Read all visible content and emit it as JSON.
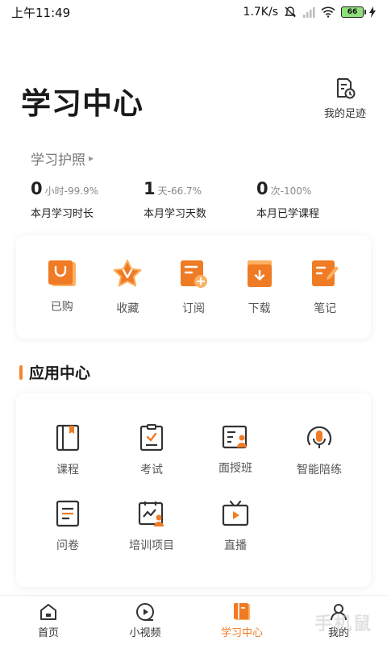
{
  "status_bar": {
    "time": "上午11:49",
    "net_speed": "1.7K/s",
    "battery": "66"
  },
  "header": {
    "title": "学习中心",
    "footprint_label": "我的足迹"
  },
  "passport": {
    "title": "学习护照",
    "stats": [
      {
        "value": "0",
        "unit": "小时-99.9%",
        "label": "本月学习时长"
      },
      {
        "value": "1",
        "unit": "天-66.7%",
        "label": "本月学习天数"
      },
      {
        "value": "0",
        "unit": "次-100%",
        "label": "本月已学课程"
      }
    ]
  },
  "quick_actions": [
    {
      "label": "已购",
      "icon": "bag-icon"
    },
    {
      "label": "收藏",
      "icon": "star-icon"
    },
    {
      "label": "订阅",
      "icon": "subscribe-icon"
    },
    {
      "label": "下载",
      "icon": "download-icon"
    },
    {
      "label": "笔记",
      "icon": "note-icon"
    }
  ],
  "app_center": {
    "title": "应用中心",
    "items": [
      {
        "label": "课程",
        "icon": "book-icon"
      },
      {
        "label": "考试",
        "icon": "exam-icon"
      },
      {
        "label": "面授班",
        "icon": "classroom-icon"
      },
      {
        "label": "智能陪练",
        "icon": "microphone-icon"
      },
      {
        "label": "问卷",
        "icon": "survey-icon"
      },
      {
        "label": "培训项目",
        "icon": "training-project-icon"
      },
      {
        "label": "直播",
        "icon": "live-icon"
      }
    ]
  },
  "bottom_nav": [
    {
      "label": "首页",
      "icon": "home-icon"
    },
    {
      "label": "小视频",
      "icon": "video-icon"
    },
    {
      "label": "学习中心",
      "icon": "study-center-icon"
    },
    {
      "label": "我的",
      "icon": "profile-icon"
    }
  ],
  "watermark": "手机鼠",
  "colors": {
    "accent": "#f07b25",
    "accent_light": "#fbb062"
  }
}
